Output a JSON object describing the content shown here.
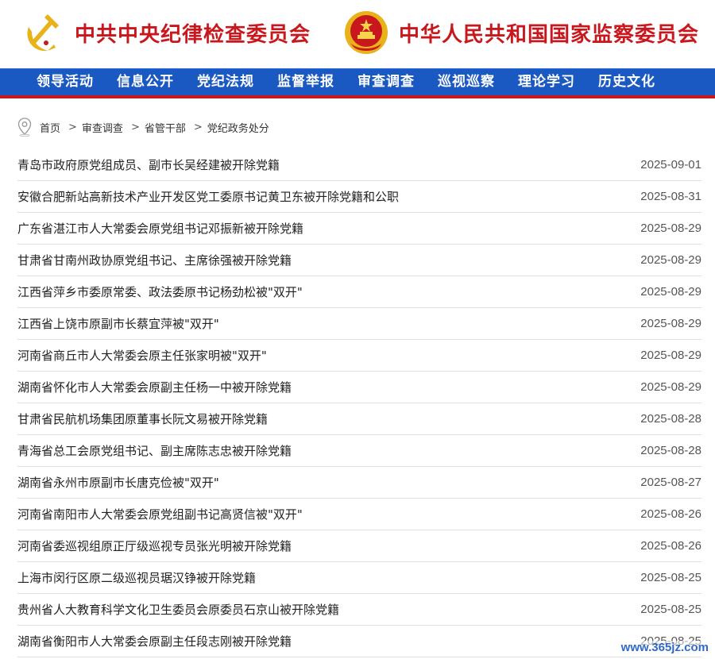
{
  "header": {
    "left_org": "中共中央纪律检查委员会",
    "right_org": "中华人民共和国国家监察委员会",
    "left_emblem_icon": "party-emblem-icon",
    "right_emblem_icon": "national-emblem-icon",
    "brand_red": "#c8171d"
  },
  "nav": {
    "color": "#1b59c2",
    "items": [
      "领导活动",
      "信息公开",
      "党纪法规",
      "监督举报",
      "审查调查",
      "巡视巡察",
      "理论学习",
      "历史文化"
    ]
  },
  "breadcrumb": {
    "icon": "location-pin-icon",
    "items": [
      "首页",
      "审查调查",
      "省管干部",
      "党纪政务处分"
    ],
    "separator": ">"
  },
  "articles": [
    {
      "title": "青岛市政府原党组成员、副市长吴经建被开除党籍",
      "date": "2025-09-01"
    },
    {
      "title": "安徽合肥新站高新技术产业开发区党工委原书记黄卫东被开除党籍和公职",
      "date": "2025-08-31"
    },
    {
      "title": "广东省湛江市人大常委会原党组书记邓振新被开除党籍",
      "date": "2025-08-29"
    },
    {
      "title": "甘肃省甘南州政协原党组书记、主席徐强被开除党籍",
      "date": "2025-08-29"
    },
    {
      "title": "江西省萍乡市委原常委、政法委原书记杨劲松被\"双开\"",
      "date": "2025-08-29"
    },
    {
      "title": "江西省上饶市原副市长蔡宜萍被\"双开\"",
      "date": "2025-08-29"
    },
    {
      "title": "河南省商丘市人大常委会原主任张家明被\"双开\"",
      "date": "2025-08-29"
    },
    {
      "title": "湖南省怀化市人大常委会原副主任杨一中被开除党籍",
      "date": "2025-08-29"
    },
    {
      "title": "甘肃省民航机场集团原董事长阮文易被开除党籍",
      "date": "2025-08-28"
    },
    {
      "title": "青海省总工会原党组书记、副主席陈志忠被开除党籍",
      "date": "2025-08-28"
    },
    {
      "title": "湖南省永州市原副市长唐克俭被\"双开\"",
      "date": "2025-08-27"
    },
    {
      "title": "河南省南阳市人大常委会原党组副书记高贤信被\"双开\"",
      "date": "2025-08-26"
    },
    {
      "title": "河南省委巡视组原正厅级巡视专员张光明被开除党籍",
      "date": "2025-08-26"
    },
    {
      "title": "上海市闵行区原二级巡视员琚汉铮被开除党籍",
      "date": "2025-08-25"
    },
    {
      "title": "贵州省人大教育科学文化卫生委员会原委员石京山被开除党籍",
      "date": "2025-08-25"
    },
    {
      "title": "湖南省衡阳市人大常委会原副主任段志刚被开除党籍",
      "date": "2025-08-25"
    }
  ],
  "watermark": "www.365jz.com"
}
